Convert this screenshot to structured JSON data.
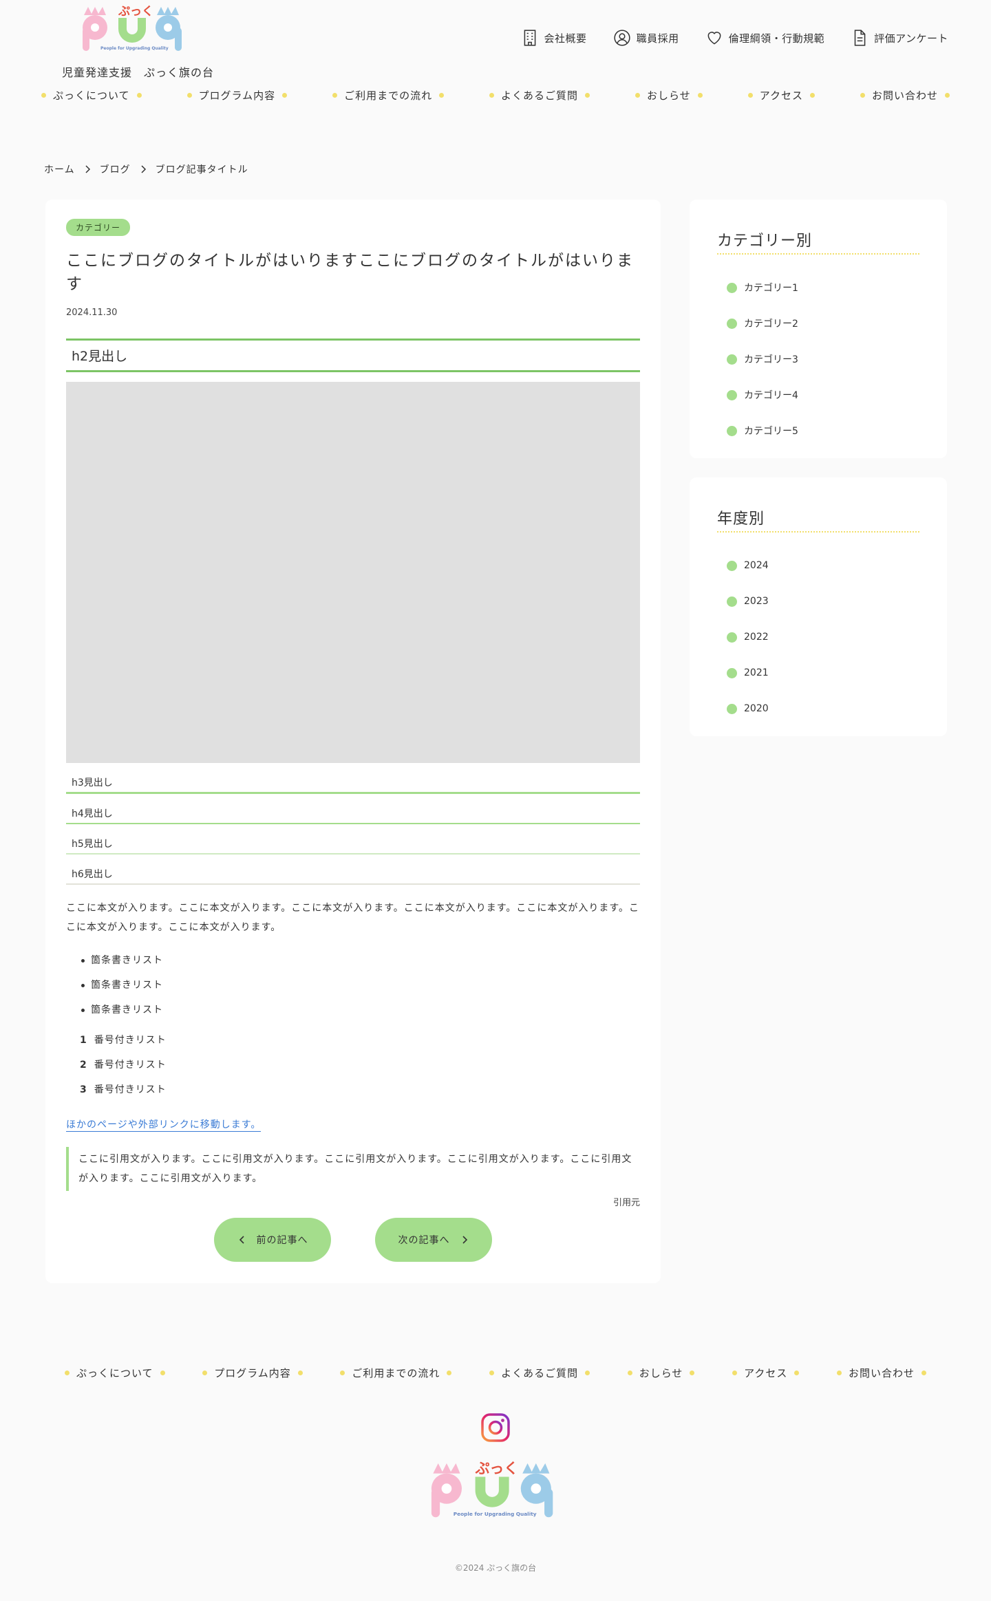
{
  "header": {
    "logo_text": "ぷっく",
    "logo_sub": "People for Upgrading Quality",
    "tagline": "児童発達支援　ぷっく旗の台",
    "util_nav": [
      {
        "label": "会社概要",
        "icon": "building-icon"
      },
      {
        "label": "職員採用",
        "icon": "user-icon"
      },
      {
        "label": "倫理綱領・行動規範",
        "icon": "heart-icon"
      },
      {
        "label": "評価アンケート",
        "icon": "document-icon"
      }
    ],
    "global_nav": [
      "ぷっくについて",
      "プログラム内容",
      "ご利用までの流れ",
      "よくあるご質問",
      "おしらせ",
      "アクセス",
      "お問い合わせ"
    ]
  },
  "breadcrumb": [
    "ホーム",
    "ブログ",
    "ブログ記事タイトル"
  ],
  "article": {
    "category": "カテゴリー",
    "title": "ここにブログのタイトルがはいりますここにブログのタイトルがはいります",
    "date": "2024.11.30",
    "h2": "h2見出し",
    "h3": "h3見出し",
    "h4": "h4見出し",
    "h5": "h5見出し",
    "h6": "h6見出し",
    "body": "ここに本文が入ります。ここに本文が入ります。ここに本文が入ります。ここに本文が入ります。ここに本文が入ります。ここに本文が入ります。ここに本文が入ります。",
    "bullets": [
      "箇条書きリスト",
      "箇条書きリスト",
      "箇条書きリスト"
    ],
    "numbered": [
      {
        "num": "1",
        "text": "番号付きリスト"
      },
      {
        "num": "2",
        "text": "番号付きリスト"
      },
      {
        "num": "3",
        "text": "番号付きリスト"
      }
    ],
    "link_text": "ほかのページや外部リンクに移動します。",
    "quote": "ここに引用文が入ります。ここに引用文が入ります。ここに引用文が入ります。ここに引用文が入ります。ここに引用文が入ります。ここに引用文が入ります。",
    "quote_source": "引用元",
    "prev_label": "前の記事へ",
    "next_label": "次の記事へ"
  },
  "sidebar": {
    "category_title": "カテゴリー別",
    "categories": [
      "カテゴリー1",
      "カテゴリー2",
      "カテゴリー3",
      "カテゴリー4",
      "カテゴリー5"
    ],
    "year_title": "年度別",
    "years": [
      "2024",
      "2023",
      "2022",
      "2021",
      "2020"
    ]
  },
  "footer": {
    "nav": [
      "ぷっくについて",
      "プログラム内容",
      "ご利用までの流れ",
      "よくあるご質問",
      "おしらせ",
      "アクセス",
      "お問い合わせ"
    ],
    "instagram_icon": "instagram-icon",
    "copyright": "©2024 ぷっく旗の台"
  },
  "colors": {
    "accent_green": "#a4dd8c",
    "heading_green": "#7cc465",
    "dot_yellow": "#f2df6b",
    "logo_pink": "#f7b8cf",
    "logo_green": "#a4dd8c",
    "logo_blue": "#9ccbe8",
    "logo_red": "#e4533f",
    "link_blue": "#3a7bd5"
  }
}
